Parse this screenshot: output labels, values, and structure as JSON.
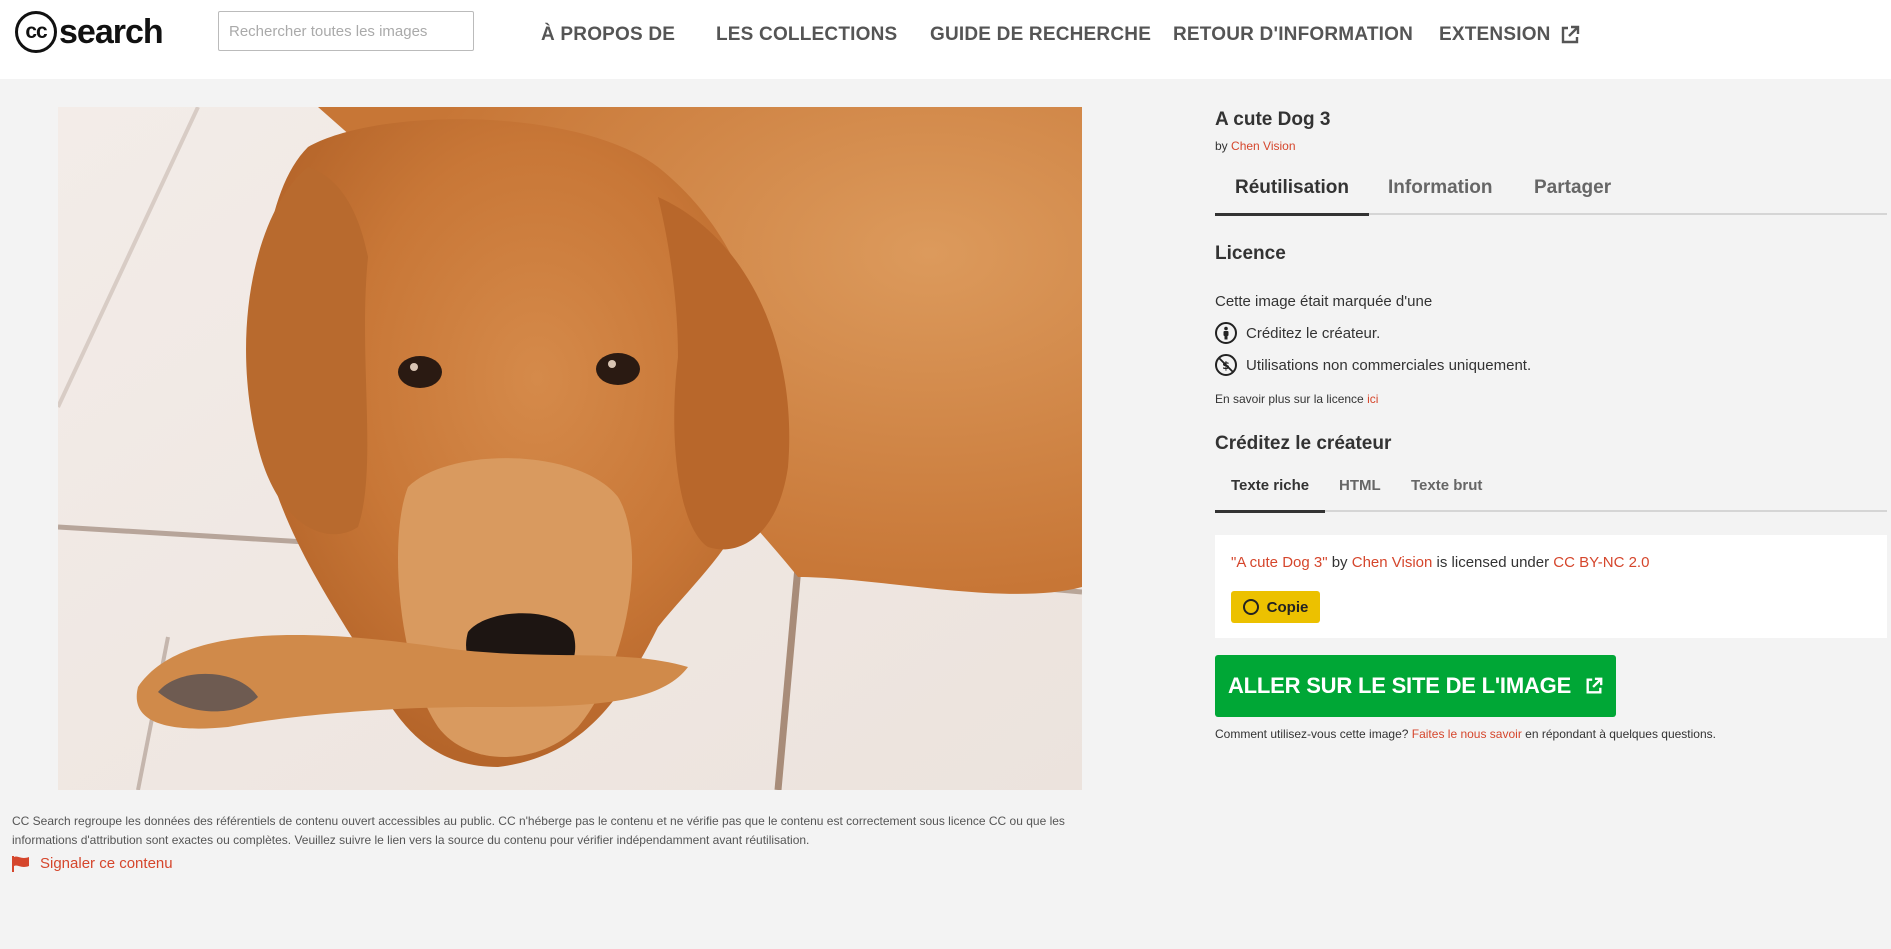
{
  "header": {
    "logo_cc": "cc",
    "logo_text": "search",
    "search_placeholder": "Rechercher toutes les images",
    "nav": [
      "À PROPOS DE",
      "LES COLLECTIONS",
      "GUIDE DE RECHERCHE",
      "RETOUR D'INFORMATION",
      "EXTENSION"
    ]
  },
  "image": {
    "subject": "golden retriever dog lying on tiled floor"
  },
  "footer": {
    "disclaimer": "CC Search regroupe les données des référentiels de contenu ouvert accessibles au public. CC n'héberge pas le contenu et ne vérifie pas que le contenu est correctement sous licence CC ou que les informations d'attribution sont exactes ou complètes. Veuillez suivre le lien vers la source du contenu pour vérifier indépendamment avant réutilisation.",
    "report": "Signaler ce contenu"
  },
  "panel": {
    "title": "A cute Dog 3",
    "by": "by",
    "creator": "Chen Vision",
    "tabs": [
      "Réutilisation",
      "Information",
      "Partager"
    ],
    "license_heading": "Licence",
    "license_intro": "Cette image était marquée d'une",
    "license_items": [
      "Créditez le créateur.",
      "Utilisations non commerciales uniquement."
    ],
    "learn_more": "En savoir plus sur la licence",
    "learn_more_link": "ici",
    "credit_heading": "Créditez le créateur",
    "credit_tabs": [
      "Texte riche",
      "HTML",
      "Texte brut"
    ],
    "attribution": {
      "title_quoted": "\"A cute Dog 3\"",
      "by": "by",
      "creator": "Chen Vision",
      "licensed": "is licensed under",
      "license": "CC BY-NC 2.0"
    },
    "copy_label": "Copie",
    "go_button": "ALLER SUR LE SITE DE L'IMAGE",
    "feedback_prefix": "Comment utilisez-vous cette image?",
    "feedback_link": "Faites le nous savoir",
    "feedback_suffix": "en répondant à quelques questions."
  },
  "colors": {
    "accent": "#d5462c",
    "go_button": "#00a736",
    "copy_button": "#ecc100"
  }
}
